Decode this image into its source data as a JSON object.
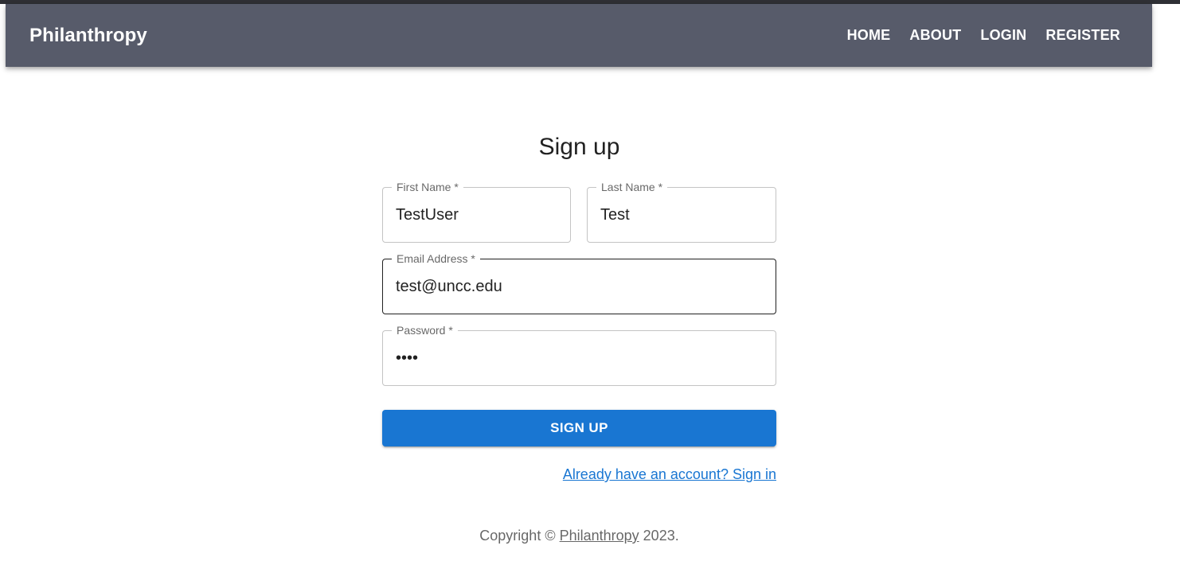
{
  "appbar": {
    "brand": "Philanthropy",
    "nav": [
      "HOME",
      "ABOUT",
      "LOGIN",
      "REGISTER"
    ],
    "background": "#575b6a"
  },
  "form": {
    "title": "Sign up",
    "first_name": {
      "label": "First Name *",
      "value": "TestUser"
    },
    "last_name": {
      "label": "Last Name *",
      "value": "Test"
    },
    "email": {
      "label": "Email Address *",
      "value": "test@uncc.edu"
    },
    "password": {
      "label": "Password *",
      "value": "••••"
    },
    "submit_label": "SIGN UP",
    "signin_link": "Already have an account? Sign in",
    "accent": "#1976d2"
  },
  "footer": {
    "prefix": "Copyright © ",
    "link": "Philanthropy",
    "suffix": " 2023."
  }
}
